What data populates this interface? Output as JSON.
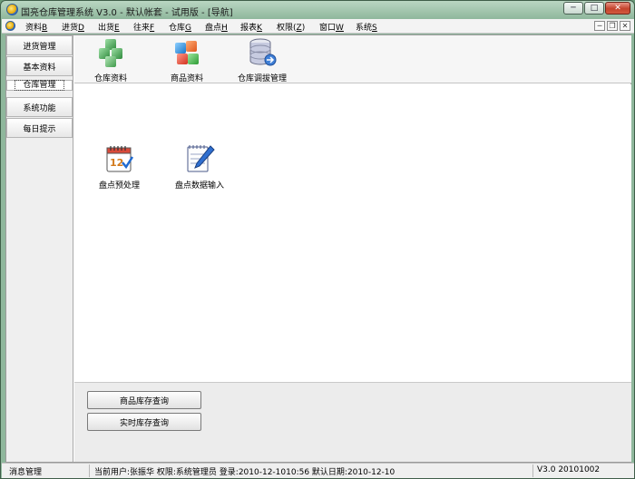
{
  "window": {
    "title": "国亮仓库管理系统 V3.0 - 默认帐套 - 试用版 - [导航]",
    "minimize": "─",
    "maximize": "□",
    "close": "✕"
  },
  "menu": {
    "items": [
      {
        "label": "资料",
        "key": "B"
      },
      {
        "label": "进货",
        "key": "D"
      },
      {
        "label": "出货",
        "key": "E"
      },
      {
        "label": "往来",
        "key": "F"
      },
      {
        "label": "仓库",
        "key": "G"
      },
      {
        "label": "盘点",
        "key": "H"
      },
      {
        "label": "报表",
        "key": "K"
      },
      {
        "label": "权限(",
        "key": "Z",
        "suffix": ")"
      },
      {
        "label": "窗口",
        "key": "W"
      },
      {
        "label": "系统",
        "key": "S"
      }
    ],
    "mdi_minimize": "─",
    "mdi_restore": "❐",
    "mdi_close": "✕"
  },
  "sidebar": {
    "items": [
      {
        "label": "进货管理"
      },
      {
        "label": "基本资料"
      },
      {
        "label": "仓库管理"
      },
      {
        "label": "系统功能"
      },
      {
        "label": "每日提示"
      }
    ],
    "active_index": 2
  },
  "toolbar": {
    "items": [
      {
        "label": "仓库资料",
        "icon": "warehouse-cubes-icon"
      },
      {
        "label": "商品资料",
        "icon": "product-cubes-icon"
      },
      {
        "label": "仓库调拔管理",
        "icon": "database-transfer-icon"
      }
    ]
  },
  "functions": {
    "items": [
      {
        "label": "盘点预处理",
        "icon": "calendar-check-icon",
        "icon_text": "12"
      },
      {
        "label": "盘点数据输入",
        "icon": "notepad-pen-icon"
      }
    ]
  },
  "queries": {
    "items": [
      {
        "label": "商品库存查询"
      },
      {
        "label": "实时库存查询"
      }
    ]
  },
  "status": {
    "message": "消息管理",
    "user_info": "当前用户:张振华 权限:系统管理员 登录:2010-12-1010:56 默认日期:2010-12-10",
    "version": "V3.0 20101002"
  },
  "colors": {
    "titlebar": "#8fb79c",
    "close_button": "#c4432c",
    "panel": "#efefef"
  }
}
